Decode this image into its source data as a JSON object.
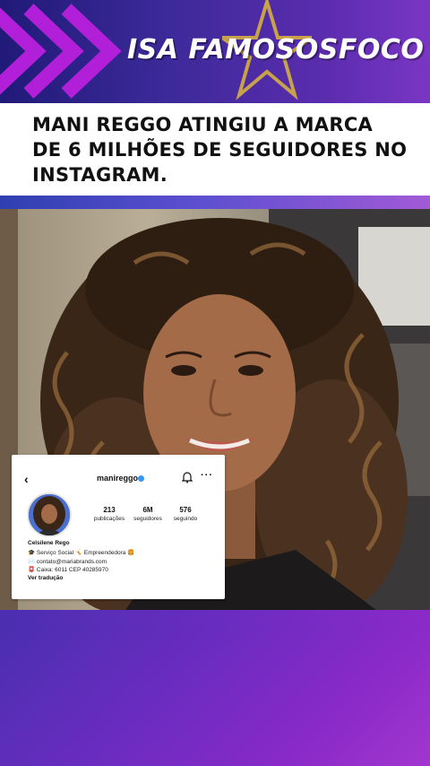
{
  "header": {
    "brand": "ISA FAMOSOSFOCO",
    "colors": {
      "chevron": "#b21fd8",
      "star": "#c8a24a"
    }
  },
  "headline": {
    "text": "MANI REGGO ATINGIU A MARCA DE 6 MILHÕES DE SEGUIDORES NO INSTAGRAM."
  },
  "instagram": {
    "back_icon": "chevron-left-icon",
    "username": "manireggo",
    "stats": [
      {
        "value": "213",
        "label": "publicações"
      },
      {
        "value": "6M",
        "label": "seguidores"
      },
      {
        "value": "576",
        "label": "seguindo"
      }
    ],
    "name": "Celsilene Rego",
    "bio": [
      "🎓 Serviço Social 🤸 Empreendedora 🍔",
      "✉️ contato@mariabrands.com",
      "📮 Caixa: 6011 CEP 40285970"
    ],
    "translate": "Ver tradução"
  }
}
